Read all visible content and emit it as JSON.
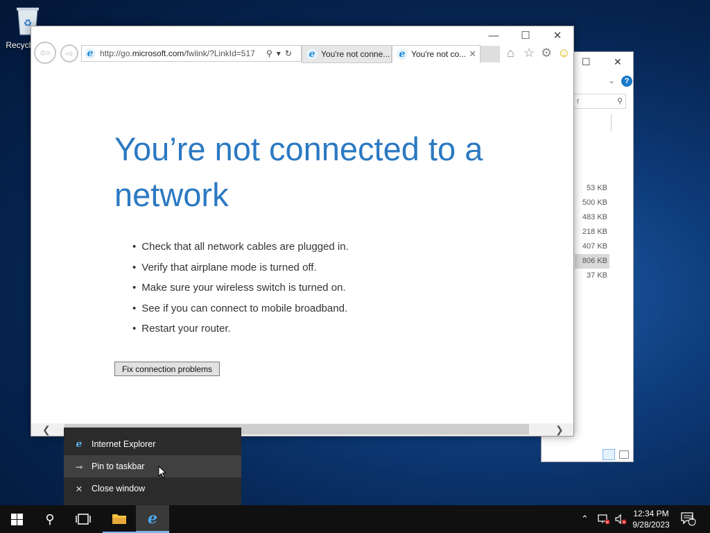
{
  "desktop": {
    "recycle_bin_label": "Recycle Bin"
  },
  "explorer": {
    "search_placeholder": "r",
    "sizes": [
      "53 KB",
      "500 KB",
      "483 KB",
      "218 KB",
      "407 KB",
      "806 KB",
      "37 KB"
    ],
    "selected_size": "806 KB",
    "help": "?"
  },
  "ie": {
    "address": {
      "prefix": "http://go.",
      "domain": "microsoft.com",
      "rest": "/fwlink/?LinkId=517"
    },
    "tabs": [
      {
        "title": "You're not conne...",
        "active": false
      },
      {
        "title": "You're not co...",
        "active": true
      }
    ],
    "window_controls": {
      "minimize": "—",
      "maximize": "☐",
      "close": "✕"
    },
    "headline": "You’re not connected to a network",
    "tips": [
      "Check that all network cables are plugged in.",
      "Verify that airplane mode is turned off.",
      "Make sure your wireless switch is turned on.",
      "See if you can connect to mobile broadband.",
      "Restart your router."
    ],
    "fix_button": "Fix connection problems"
  },
  "jumplist": {
    "items": [
      "Internet Explorer",
      "Pin to taskbar",
      "Close window"
    ],
    "hovered": "Pin to taskbar"
  },
  "taskbar": {
    "time": "12:34 PM",
    "date": "9/28/2023",
    "notification_count": "1"
  },
  "colors": {
    "accent": "#2b79c2",
    "taskbar": "#101010",
    "jumplist": "#2b2b2b"
  }
}
